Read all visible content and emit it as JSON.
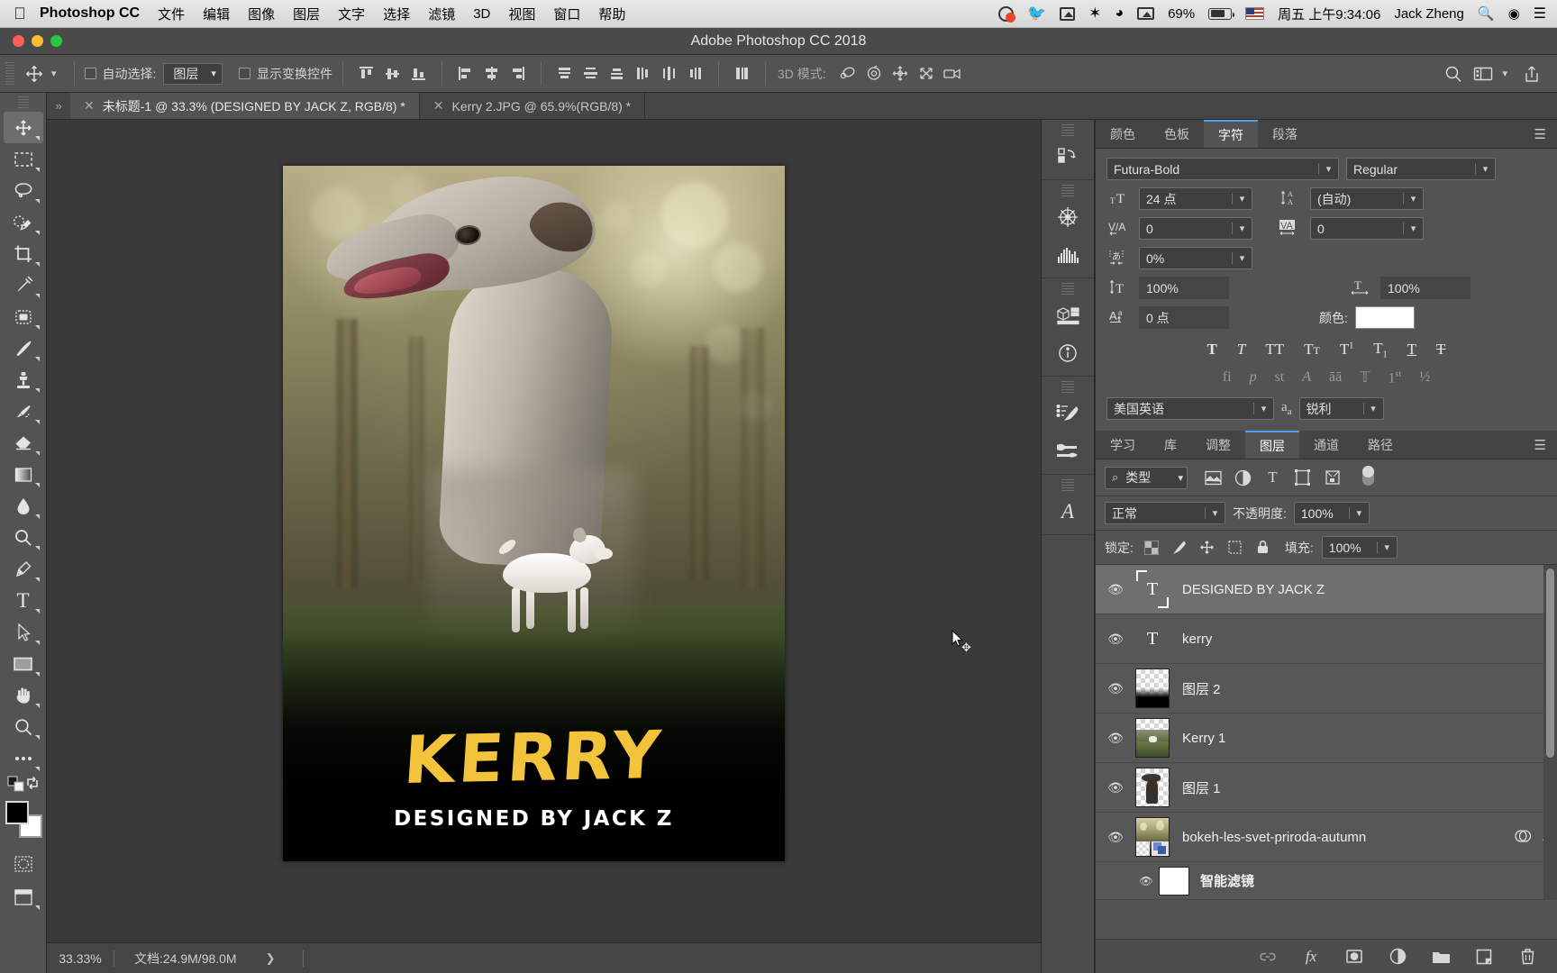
{
  "macbar": {
    "apple_icon": "apple-icon",
    "app_name": "Photoshop CC",
    "menus": [
      "文件",
      "编辑",
      "图像",
      "图层",
      "文字",
      "选择",
      "滤镜",
      "3D",
      "视图",
      "窗口",
      "帮助"
    ],
    "status": {
      "battery_percent": "69%",
      "datetime": "周五 上午9:34:06",
      "user": "Jack Zheng"
    }
  },
  "window": {
    "title": "Adobe Photoshop CC 2018"
  },
  "options_bar": {
    "tool_icon": "move-tool-icon",
    "auto_select_label": "自动选择:",
    "auto_select_value": "图层",
    "show_transform_label": "显示变换控件",
    "mode_3d_label": "3D 模式:",
    "align_icons": [
      "align-top-edges-icon",
      "align-vertical-centers-icon",
      "align-bottom-edges-icon",
      "align-left-edges-icon",
      "align-horizontal-centers-icon",
      "align-right-edges-icon"
    ],
    "distribute_icons": [
      "distribute-top-edges-icon",
      "distribute-vertical-centers-icon",
      "distribute-bottom-edges-icon",
      "distribute-left-edges-icon",
      "distribute-horizontal-centers-icon",
      "distribute-right-edges-icon"
    ],
    "auto_distribute_icon": "auto-distribute-icon",
    "mode3d_icons": [
      "rotate-3d-icon",
      "roll-3d-icon",
      "pan-3d-icon",
      "slide-3d-icon",
      "camera-3d-icon"
    ],
    "right_icons": [
      "search-icon",
      "workspace-icon",
      "chevron-down-icon",
      "share-icon"
    ]
  },
  "toolbar": {
    "tools": [
      {
        "name": "move-tool",
        "glyph": "✥",
        "active": true,
        "corner": true
      },
      {
        "name": "rectangular-marquee-tool",
        "glyph": "▭",
        "active": false,
        "corner": true
      },
      {
        "name": "lasso-tool",
        "glyph": "◯",
        "active": false,
        "corner": true
      },
      {
        "name": "quick-selection-tool",
        "glyph": "✧",
        "active": false,
        "corner": true
      },
      {
        "name": "crop-tool",
        "glyph": "⌗",
        "active": false,
        "corner": true
      },
      {
        "name": "eyedropper-tool",
        "glyph": "✎",
        "active": false,
        "corner": true
      },
      {
        "name": "spot-healing-brush-tool",
        "glyph": "⬚",
        "active": false,
        "corner": true
      },
      {
        "name": "brush-tool",
        "glyph": "🖌",
        "active": false,
        "corner": true
      },
      {
        "name": "clone-stamp-tool",
        "glyph": "⚲",
        "active": false,
        "corner": true
      },
      {
        "name": "history-brush-tool",
        "glyph": "↯",
        "active": false,
        "corner": true
      },
      {
        "name": "eraser-tool",
        "glyph": "◨",
        "active": false,
        "corner": true
      },
      {
        "name": "gradient-tool",
        "glyph": "▤",
        "active": false,
        "corner": true
      },
      {
        "name": "blur-tool",
        "glyph": "💧",
        "active": false,
        "corner": true
      },
      {
        "name": "dodge-tool",
        "glyph": "🔍",
        "active": false,
        "corner": true
      },
      {
        "name": "pen-tool",
        "glyph": "✒",
        "active": false,
        "corner": true
      },
      {
        "name": "horizontal-type-tool",
        "glyph": "T",
        "active": false,
        "corner": true
      },
      {
        "name": "path-selection-tool",
        "glyph": "➤",
        "active": false,
        "corner": true
      },
      {
        "name": "rectangle-tool",
        "glyph": "▢",
        "active": false,
        "corner": true
      },
      {
        "name": "hand-tool",
        "glyph": "✋",
        "active": false,
        "corner": true
      },
      {
        "name": "zoom-tool",
        "glyph": "🔎",
        "active": false,
        "corner": true
      },
      {
        "name": "edit-toolbar",
        "glyph": "⋯",
        "active": false,
        "corner": true
      }
    ],
    "foreground_color": "#000000",
    "background_color": "#ffffff"
  },
  "document_tabs": [
    {
      "title": "未标题-1 @ 33.3% (DESIGNED BY JACK Z, RGB/8) *",
      "active": true
    },
    {
      "title": "Kerry 2.JPG @ 65.9%(RGB/8) *",
      "active": false
    }
  ],
  "canvas": {
    "artwork_title": "KERRY",
    "artwork_subtitle": "DESIGNED BY JACK Z",
    "title_color": "#f3c33c",
    "subtitle_color": "#ffffff"
  },
  "status_bar": {
    "zoom": "33.33%",
    "doc_info": "文档:24.9M/98.0M",
    "expand_icon": "chevron-right-icon"
  },
  "icon_dock": {
    "groups": [
      [
        "history-icon"
      ],
      [
        "navigator-icon",
        "histogram-icon"
      ],
      [
        "3d-icon",
        "info-icon"
      ],
      [
        "brush-settings-icon",
        "brush-presets-icon"
      ],
      [
        "glyphs-icon"
      ]
    ]
  },
  "character_panel": {
    "tabs": [
      {
        "label": "颜色",
        "active": false
      },
      {
        "label": "色板",
        "active": false
      },
      {
        "label": "字符",
        "active": true
      },
      {
        "label": "段落",
        "active": false
      }
    ],
    "menu_icon": "panel-menu-icon",
    "font_family": "Futura-Bold",
    "font_style": "Regular",
    "font_size_icon": "font-size-icon",
    "font_size": "24 点",
    "leading_icon": "leading-icon",
    "leading": "(自动)",
    "kerning_icon": "kerning-icon",
    "kerning": "0",
    "tracking_icon": "tracking-icon",
    "tracking": "0",
    "tsume_icon": "tsume-icon",
    "tsume": "0%",
    "vscale_icon": "vertical-scale-icon",
    "vertical_scale": "100%",
    "hscale_icon": "horizontal-scale-icon",
    "horizontal_scale": "100%",
    "baseline_icon": "baseline-shift-icon",
    "baseline_shift": "0 点",
    "color_label": "颜色:",
    "color_value": "#ffffff",
    "style_buttons": [
      "faux-bold-icon",
      "faux-italic-icon",
      "all-caps-icon",
      "small-caps-icon",
      "superscript-icon",
      "subscript-icon",
      "underline-icon",
      "strikethrough-icon"
    ],
    "opentype_buttons": [
      "standard-ligatures-icon",
      "contextual-alternates-icon",
      "discretionary-ligatures-icon",
      "swash-icon",
      "stylistic-alternates-icon",
      "titling-alternates-icon",
      "ordinals-icon",
      "fractions-icon"
    ],
    "language": "美国英语",
    "antialias_icon": "anti-aliasing-icon",
    "antialias": "锐利"
  },
  "layers_panel": {
    "tabs": [
      {
        "label": "学习",
        "active": false
      },
      {
        "label": "库",
        "active": false
      },
      {
        "label": "调整",
        "active": false
      },
      {
        "label": "图层",
        "active": true
      },
      {
        "label": "通道",
        "active": false
      },
      {
        "label": "路径",
        "active": false
      }
    ],
    "menu_icon": "panel-menu-icon",
    "filter_kind_icon": "search-icon",
    "filter_kind": "类型",
    "filter_icons": [
      "filter-pixel-icon",
      "filter-adjustment-icon",
      "filter-type-icon",
      "filter-shape-icon",
      "filter-smart-object-icon"
    ],
    "filter_toggle_icon": "filter-toggle-icon",
    "blend_mode": "正常",
    "opacity_label": "不透明度:",
    "opacity": "100%",
    "lock_label": "锁定:",
    "lock_icons": [
      "lock-transparent-pixels-icon",
      "lock-image-pixels-icon",
      "lock-position-icon",
      "lock-artboard-icon",
      "lock-all-icon"
    ],
    "fill_label": "填充:",
    "fill": "100%",
    "layers": [
      {
        "name": "DESIGNED BY JACK Z",
        "type": "text",
        "visible": true,
        "selected": true,
        "thumb": "text-thumb-selected"
      },
      {
        "name": "kerry",
        "type": "text",
        "visible": true,
        "selected": false,
        "thumb": "text-thumb"
      },
      {
        "name": "图层 2",
        "type": "pixel",
        "visible": true,
        "selected": false,
        "thumb": "gradient-thumb"
      },
      {
        "name": "Kerry 1",
        "type": "pixel",
        "visible": true,
        "selected": false,
        "thumb": "photo-thumb-dog-small"
      },
      {
        "name": "图层 1",
        "type": "pixel",
        "visible": true,
        "selected": false,
        "thumb": "photo-thumb-dog-big"
      },
      {
        "name": "bokeh-les-svet-priroda-autumn",
        "type": "smart-object",
        "visible": true,
        "selected": false,
        "thumb": "photo-thumb-forest",
        "badges": [
          "smart-filter-icon",
          "collapse-icon"
        ]
      }
    ],
    "smart_filter": {
      "name": "智能滤镜",
      "visible": true
    },
    "footer_icons": [
      "link-layers-icon",
      "add-layer-style-icon",
      "add-layer-mask-icon",
      "new-fill-adjustment-icon",
      "new-group-icon",
      "new-layer-icon",
      "delete-layer-icon"
    ]
  }
}
